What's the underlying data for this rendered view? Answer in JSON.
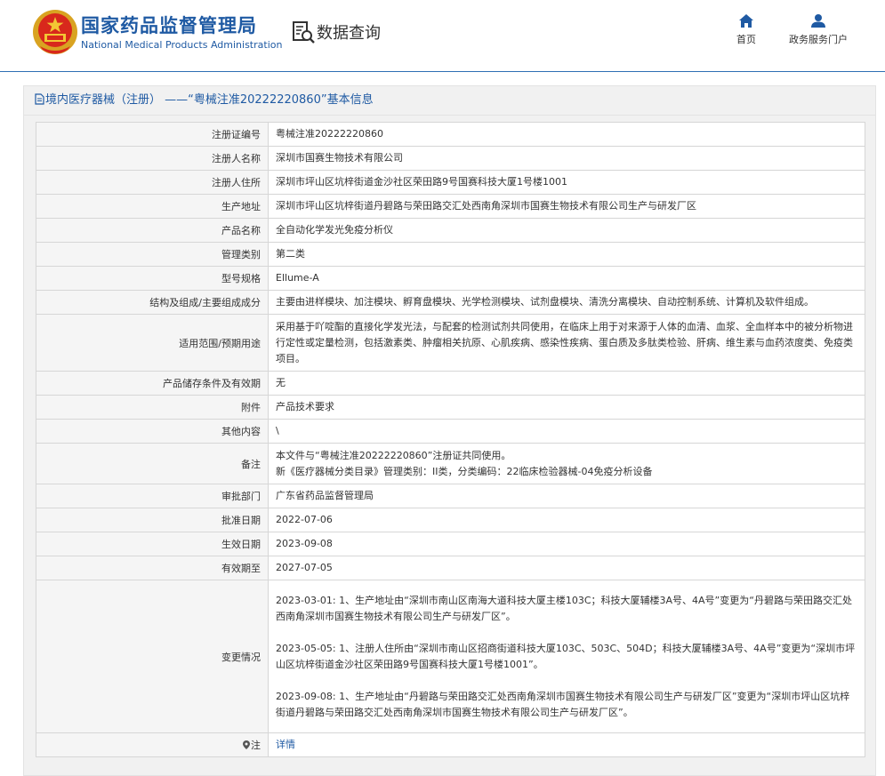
{
  "header": {
    "brand_cn": "国家药品监督管理局",
    "brand_en": "National Medical Products Administration",
    "data_query": "数据查询",
    "nav": [
      {
        "label": "首页",
        "icon": "home-icon"
      },
      {
        "label": "政务服务门户",
        "icon": "user-icon"
      }
    ]
  },
  "panel": {
    "title": "境内医疗器械（注册） ——“粤械注准20222220860”基本信息"
  },
  "rows": [
    {
      "label": "注册证编号",
      "value": "粤械注准20222220860"
    },
    {
      "label": "注册人名称",
      "value": "深圳市国赛生物技术有限公司"
    },
    {
      "label": "注册人住所",
      "value": "深圳市坪山区坑梓街道金沙社区荣田路9号国赛科技大厦1号楼1001"
    },
    {
      "label": "生产地址",
      "value": "深圳市坪山区坑梓街道丹碧路与荣田路交汇处西南角深圳市国赛生物技术有限公司生产与研发厂区"
    },
    {
      "label": "产品名称",
      "value": "全自动化学发光免疫分析仪"
    },
    {
      "label": "管理类别",
      "value": "第二类"
    },
    {
      "label": "型号规格",
      "value": "Ellume-A"
    },
    {
      "label": "结构及组成/主要组成成分",
      "value": "主要由进样模块、加注模块、孵育盘模块、光学检测模块、试剂盘模块、清洗分离模块、自动控制系统、计算机及软件组成。"
    },
    {
      "label": "适用范围/预期用途",
      "value": "采用基于吖啶酯的直接化学发光法，与配套的检测试剂共同使用，在临床上用于对来源于人体的血清、血浆、全血样本中的被分析物进行定性或定量检测，包括激素类、肿瘤相关抗原、心肌疾病、感染性疾病、蛋白质及多肽类检验、肝病、维生素与血药浓度类、免疫类项目。"
    },
    {
      "label": "产品储存条件及有效期",
      "value": "无"
    },
    {
      "label": "附件",
      "value": "产品技术要求"
    },
    {
      "label": "其他内容",
      "value": "\\"
    },
    {
      "label": "备注",
      "lines": [
        "本文件与“粤械注准20222220860”注册证共同使用。",
        "新《医疗器械分类目录》管理类别：II类，分类编码：22临床检验器械-04免疫分析设备"
      ]
    },
    {
      "label": "审批部门",
      "value": "广东省药品监督管理局"
    },
    {
      "label": "批准日期",
      "value": "2022-07-06"
    },
    {
      "label": "生效日期",
      "value": "2023-09-08"
    },
    {
      "label": "有效期至",
      "value": "2027-07-05"
    },
    {
      "label": "变更情况",
      "lines": [
        "2023-03-01: 1、生产地址由“深圳市南山区南海大道科技大厦主楼103C；科技大厦辅楼3A号、4A号”变更为“丹碧路与荣田路交汇处西南角深圳市国赛生物技术有限公司生产与研发厂区”。",
        "2023-05-05: 1、注册人住所由“深圳市南山区招商街道科技大厦103C、503C、504D；科技大厦辅楼3A号、4A号”变更为“深圳市坪山区坑梓街道金沙社区荣田路9号国赛科技大厦1号楼1001”。",
        "2023-09-08: 1、生产地址由“丹碧路与荣田路交汇处西南角深圳市国赛生物技术有限公司生产与研发厂区”变更为“深圳市坪山区坑梓街道丹碧路与荣田路交汇处西南角深圳市国赛生物技术有限公司生产与研发厂区”。"
      ]
    },
    {
      "label": "注",
      "icon": "pin-icon",
      "link": "详情"
    }
  ]
}
